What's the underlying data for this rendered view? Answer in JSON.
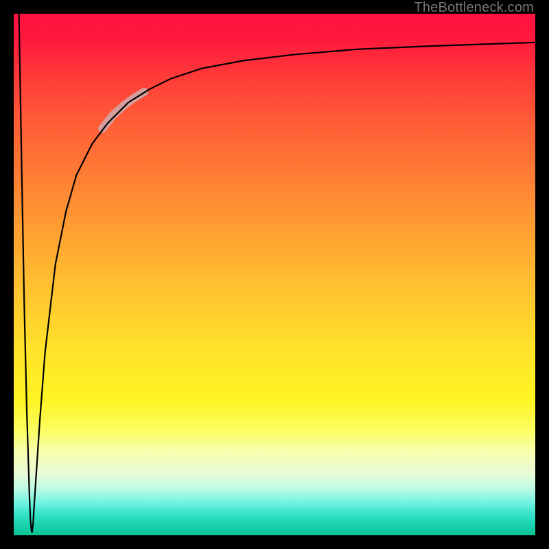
{
  "watermark": "TheBottleneck.com",
  "chart_data": {
    "type": "line",
    "title": "",
    "xlabel": "",
    "ylabel": "",
    "xlim": [
      0,
      100
    ],
    "ylim": [
      0,
      100
    ],
    "grid": false,
    "legend": false,
    "annotations": [
      {
        "text": "TheBottleneck.com",
        "pos": "top-right",
        "color": "#777777"
      }
    ],
    "series": [
      {
        "name": "curve",
        "color": "#000000",
        "x": [
          1,
          1.5,
          2,
          2.5,
          3,
          3.2,
          3.4,
          3.5,
          3.7,
          4,
          5,
          6,
          8,
          10,
          12,
          15,
          18,
          22,
          26,
          30,
          36,
          44,
          54,
          66,
          80,
          100
        ],
        "y": [
          100,
          72,
          45,
          24,
          8,
          3,
          1,
          0.5,
          2,
          7,
          22,
          35,
          52,
          62,
          69,
          75,
          79,
          83,
          85.5,
          87.5,
          89.5,
          91,
          92.2,
          93.2,
          93.8,
          94.5
        ]
      },
      {
        "name": "highlight-segment",
        "color": "#d69d9d",
        "thickness": 12,
        "x": [
          17,
          19,
          21,
          23,
          25
        ],
        "y": [
          78,
          80.5,
          82.3,
          83.8,
          85
        ]
      }
    ]
  },
  "colors": {
    "frame": "#000000",
    "curve": "#000000",
    "highlight": "#d69d9d",
    "watermark": "#777777"
  }
}
